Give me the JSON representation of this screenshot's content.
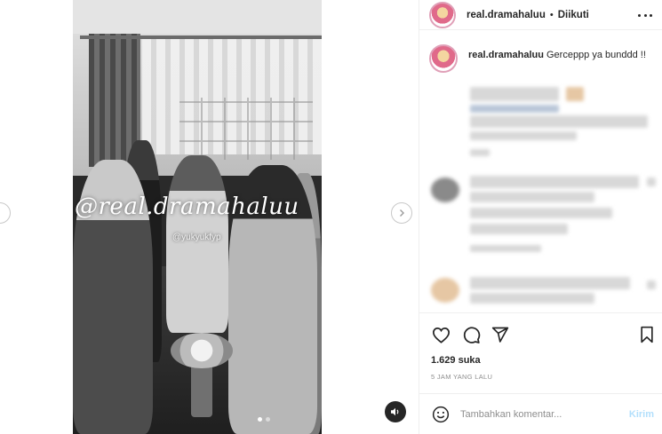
{
  "post": {
    "watermark_main": "@real.dramahaluu",
    "watermark_sub": "@yukyukfyp",
    "carousel": {
      "count": 2,
      "active_index": 0
    }
  },
  "header": {
    "username": "real.dramahaluu",
    "separator": "•",
    "follow_status": "Diikuti"
  },
  "caption": {
    "username": "real.dramahaluu",
    "text": "Gerceppp ya bunddd !!"
  },
  "stats": {
    "likes": "1.629 suka",
    "time": "5 JAM YANG LALU"
  },
  "comment_box": {
    "placeholder": "Tambahkan komentar...",
    "send_label": "Kirim"
  },
  "icons": {
    "like": "heart-icon",
    "comment": "comment-icon",
    "share": "send-icon",
    "save": "bookmark-icon",
    "emoji": "emoji-icon",
    "more": "more-options-icon",
    "mute": "audio-icon",
    "next": "chevron-right-icon"
  },
  "colors": {
    "text": "#262626",
    "muted": "#8e8e8e",
    "border": "#efefef",
    "send_disabled": "#b2dffc"
  }
}
